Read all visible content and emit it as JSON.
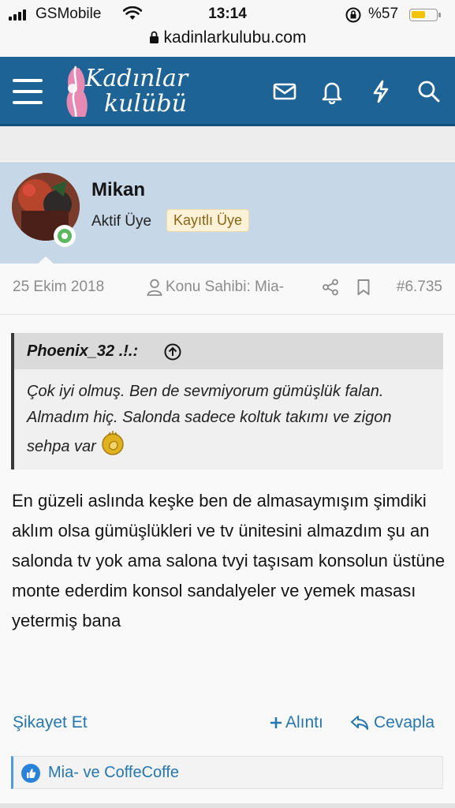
{
  "status_bar": {
    "carrier": "GSMobile",
    "time": "13:14",
    "battery_percent": "%57",
    "battery_level": 0.57
  },
  "browser": {
    "url": "kadinlarkulubu.com"
  },
  "header": {
    "logo_line1": "Kadınlar",
    "logo_line2": "kulübü",
    "icons": [
      "menu-icon",
      "mail-icon",
      "bell-icon",
      "bolt-icon",
      "search-icon"
    ],
    "color": "#1e6395"
  },
  "post": {
    "username": "Mikan",
    "user_title": "Aktif Üye",
    "badge": "Kayıtlı Üye",
    "date": "25 Ekim 2018",
    "thread_starter": "Konu Sahibi: Mia-",
    "post_number": "#6.735",
    "quote": {
      "author": "Phoenix_32 .!.:",
      "text": "Çok iyi olmuş. Ben de sevmiyorum gümüşlük falan. Almadım hiç. Salonda sadece koltuk takımı ve zigon sehpa var"
    },
    "message": "En güzeli aslında keşke ben de almasaymışım şimdiki aklım olsa gümüşlükleri ve tv ünitesini almazdım şu an salonda tv yok ama salona tvyi taşısam konsolun üstüne monte ederdim konsol sandalyeler ve yemek masası yetermiş bana",
    "actions": {
      "report": "Şikayet Et",
      "quote": "Alıntı",
      "reply": "Cevapla"
    },
    "reactions": "Mia- ve CoffeCoffe"
  }
}
